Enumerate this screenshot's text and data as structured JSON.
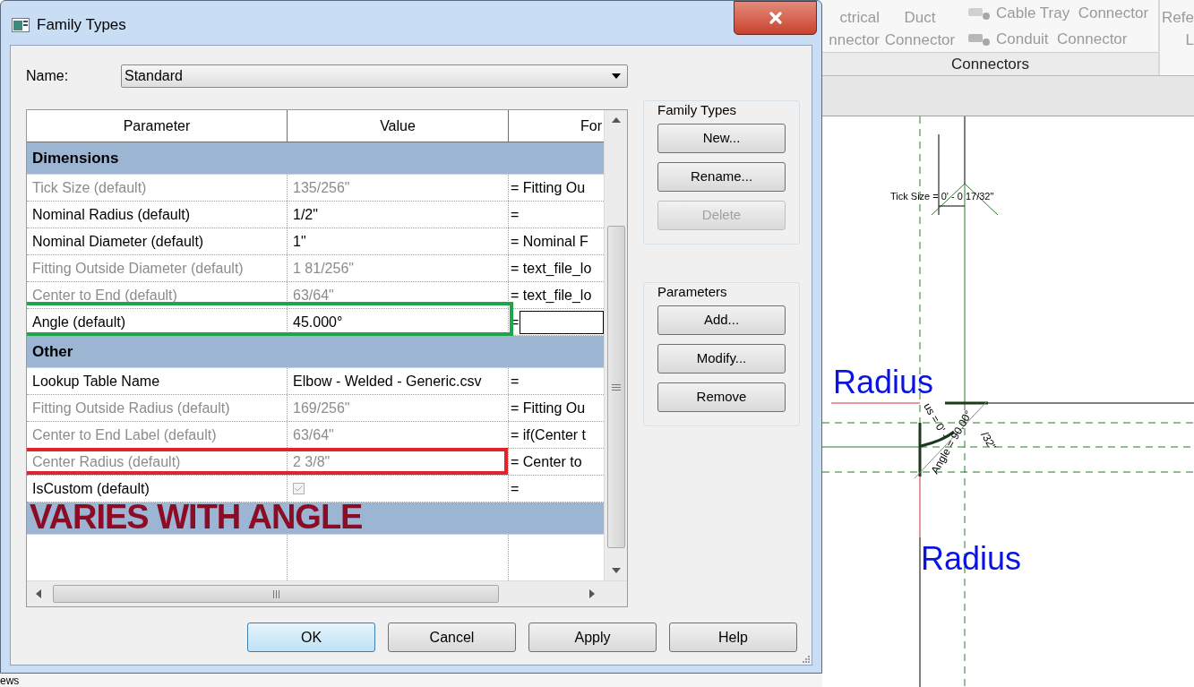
{
  "dialog": {
    "title": "Family Types",
    "name_label": "Name:",
    "name_value": "Standard",
    "table": {
      "columns": [
        "Parameter",
        "Value",
        "For"
      ],
      "rows": [
        {
          "kind": "group",
          "label": "Dimensions"
        },
        {
          "kind": "param",
          "parameter": "Tick Size (default)",
          "value": "135/256\"",
          "formula": "= Fitting Ou",
          "disabled": true
        },
        {
          "kind": "param",
          "parameter": "Nominal Radius (default)",
          "value": "1/2\"",
          "formula": "=",
          "disabled": false
        },
        {
          "kind": "param",
          "parameter": "Nominal Diameter (default)",
          "value": "1\"",
          "formula": "= Nominal F",
          "disabled": false
        },
        {
          "kind": "param",
          "parameter": "Fitting Outside Diameter (default)",
          "value": "1 81/256\"",
          "formula": "= text_file_lo",
          "disabled": true
        },
        {
          "kind": "param",
          "parameter": "Center to End (default)",
          "value": "63/64\"",
          "formula": "= text_file_lo",
          "disabled": true
        },
        {
          "kind": "param",
          "parameter": "Angle (default)",
          "value": "45.000°",
          "formula": "=",
          "disabled": false,
          "editing": true,
          "color": "#1ea64b"
        },
        {
          "kind": "group",
          "label": "Other"
        },
        {
          "kind": "param",
          "parameter": "Lookup Table Name",
          "value": "Elbow - Welded - Generic.csv",
          "formula": "=",
          "disabled": false
        },
        {
          "kind": "param",
          "parameter": "Fitting Outside Radius (default)",
          "value": "169/256\"",
          "formula": "= Fitting Ou",
          "disabled": true
        },
        {
          "kind": "param",
          "parameter": "Center to End Label (default)",
          "value": "63/64\"",
          "formula": "= if(Center t",
          "disabled": true
        },
        {
          "kind": "param",
          "parameter": "Center Radius (default)",
          "value": "2 3/8\"",
          "formula": "= Center to",
          "disabled": true,
          "color": "#e2232c"
        },
        {
          "kind": "checkbox",
          "parameter": "IsCustom (default)",
          "checked": true,
          "formula": "=",
          "disabled": false
        },
        {
          "kind": "group",
          "annotation": "VARIES WITH ANGLE"
        }
      ]
    },
    "family_types": {
      "title": "Family Types",
      "buttons": [
        {
          "label": "New...",
          "disabled": false
        },
        {
          "label": "Rename...",
          "disabled": false
        },
        {
          "label": "Delete",
          "disabled": true
        }
      ]
    },
    "parameters": {
      "title": "Parameters",
      "buttons": [
        {
          "label": "Add...",
          "disabled": false
        },
        {
          "label": "Modify...",
          "disabled": false
        },
        {
          "label": "Remove",
          "disabled": false
        }
      ]
    },
    "footer_buttons": [
      {
        "label": "OK",
        "default": true
      },
      {
        "label": "Cancel",
        "default": false
      },
      {
        "label": "Apply",
        "default": false
      },
      {
        "label": "Help",
        "default": false
      }
    ]
  },
  "background_text": "ews",
  "ribbon": {
    "large_items": [
      {
        "lines": [
          "ctrical",
          "nnector"
        ]
      },
      {
        "lines": [
          "Duct",
          "Connector"
        ]
      }
    ],
    "small_items": [
      "Cable Tray  Connector",
      "Conduit  Connector"
    ],
    "panel_label": "Connectors",
    "next_panel": [
      "Refe",
      "L"
    ]
  },
  "canvas": {
    "tick_label": "Tick Size = 0' - 0 17/32\"",
    "radius_labels": [
      "Radius",
      "Radius"
    ],
    "dimension_labels": [
      "us = 0' -",
      "Angle = 90.00°",
      "/32\""
    ]
  }
}
